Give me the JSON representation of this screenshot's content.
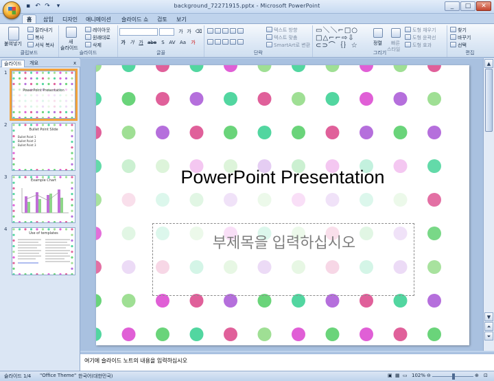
{
  "window": {
    "title": "background_72271915.pptx - Microsoft PowerPoint",
    "min": "_",
    "max": "□",
    "close": "✕"
  },
  "tabs": [
    "홈",
    "삽입",
    "디자인",
    "애니메이션",
    "슬라이드 쇼",
    "검토",
    "보기"
  ],
  "ribbon": {
    "clipboard": {
      "label": "클립보드",
      "paste": "붙여넣기",
      "cut": "잘라내기",
      "copy": "복사",
      "format": "서식 복사"
    },
    "slides": {
      "label": "슬라이드",
      "new": "새",
      "new2": "슬라이드",
      "layout": "레이아웃",
      "reset": "원래대로",
      "delete": "삭제"
    },
    "font": {
      "label": "글꼴",
      "grow": "가",
      "shrink": "가",
      "buttons": [
        "가",
        "가",
        "가",
        "abe",
        "S",
        "AV",
        "Aa",
        "가"
      ]
    },
    "paragraph": {
      "label": "단락",
      "dir": "텍스트 방향",
      "align": "텍스트 맞춤",
      "smartart": "SmartArt로 변환"
    },
    "drawing": {
      "label": "그리기",
      "arrange": "정렬",
      "quick": "빠른",
      "quick2": "스타일",
      "fill": "도형 채우기",
      "outline": "도형 윤곽선",
      "effect": "도형 효과"
    },
    "editing": {
      "label": "편집",
      "find": "찾기",
      "replace": "바꾸기",
      "select": "선택"
    }
  },
  "pane": {
    "tab_slides": "슬라이드",
    "tab_outline": "개요",
    "close": "x"
  },
  "thumbs": [
    {
      "num": "1",
      "title": "PowerPoint Presentation"
    },
    {
      "num": "2",
      "title": "Bullet Point Slide",
      "bullets": [
        "Bullet Point 1",
        "Bullet Point 2",
        "Bullet Point 3"
      ]
    },
    {
      "num": "3",
      "title": "Example Chart"
    },
    {
      "num": "4",
      "title": "Use of templates"
    }
  ],
  "slide": {
    "title": "PowerPoint Presentation",
    "subtitle": "부제목을 입력하십시오"
  },
  "notes": "여기에 슬라이드 노트의 내용을 입력하십시오",
  "status": {
    "slide": "슬라이드 1/4",
    "theme": "\"Office Theme\"",
    "lang": "한국어(대한민국)",
    "zoom": "102%"
  },
  "colors": {
    "pink": "#e0609a",
    "green": "#6ad47a",
    "purple": "#b56fdc",
    "teal": "#52d6a0",
    "magenta": "#e05fd6",
    "lightgreen": "#9fdf94"
  }
}
